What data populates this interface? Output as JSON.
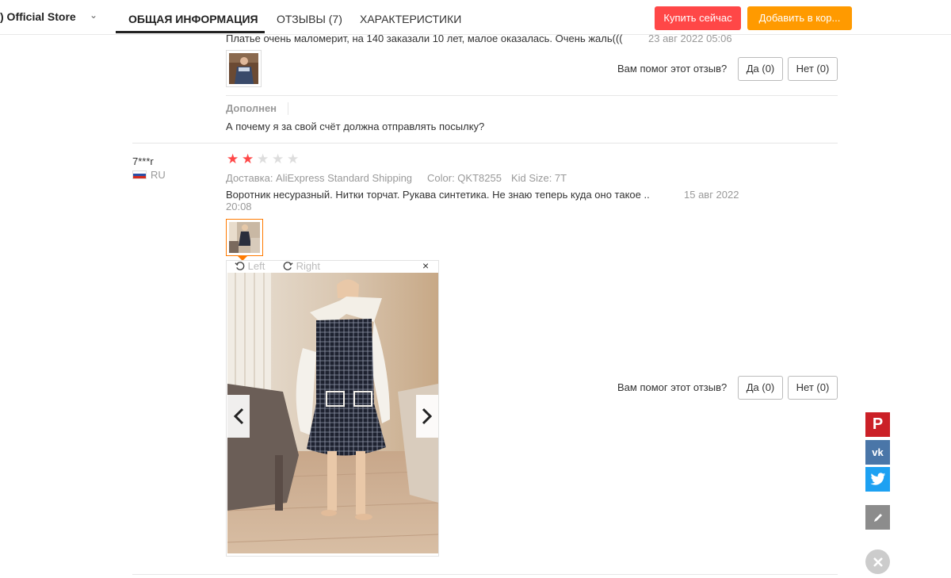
{
  "header": {
    "store_name": ") Official Store",
    "tabs": [
      {
        "label": "ОБЩАЯ ИНФОРМАЦИЯ"
      },
      {
        "label": "ОТЗЫВЫ (7)"
      },
      {
        "label": "ХАРАКТЕРИСТИКИ"
      }
    ],
    "buy_label": "Купить сейчас",
    "cart_label": "Добавить в кор..."
  },
  "review1": {
    "text": "Платье очень маломерит, на 140 заказали 10 лет, малое оказалась. Очень жаль(((",
    "date": "23 авг 2022 05:06",
    "helpful_question": "Вам помог этот отзыв?",
    "yes_label": "Да (0)",
    "no_label": "Нет (0)",
    "additional_title": "Дополнен",
    "additional_text": "А почему я за свой счёт должна отправлять посылку?"
  },
  "review2": {
    "username": "7***r",
    "country": "RU",
    "rating": 2,
    "rating_max": 5,
    "shipping": "Доставка: AliExpress Standard Shipping",
    "color": "Color: QKT8255",
    "size": "Kid Size: 7T",
    "text": "Воротник несуразный. Нитки торчат. Рукава синтетика. Не знаю теперь куда оно такое ..",
    "date_line1": "15 авг 2022",
    "date_line2": "20:08",
    "helpful_question": "Вам помог этот отзыв?",
    "yes_label": "Да (0)",
    "no_label": "Нет (0)"
  },
  "viewer": {
    "rotate_left": "Left",
    "rotate_right": "Right",
    "close_glyph": "×"
  },
  "colors": {
    "buy": "#ff4747",
    "cart": "#ff9a00",
    "pinterest": "#cb2027",
    "vk": "#4a76a8",
    "twitter": "#1da1f2",
    "edit": "#8c8c8c",
    "close": "#cccccc"
  }
}
